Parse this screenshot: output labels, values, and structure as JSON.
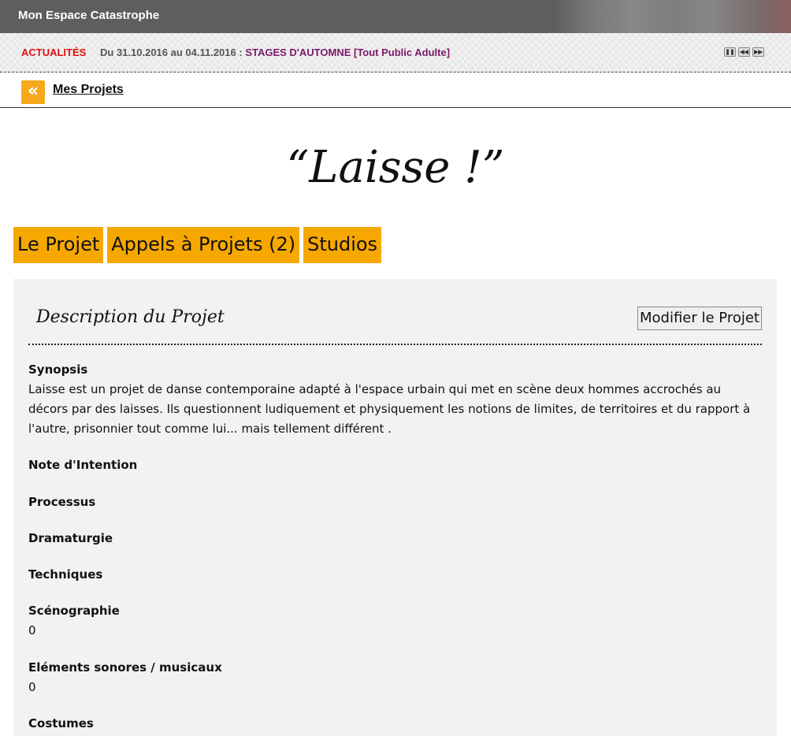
{
  "header": {
    "title": "Mon Espace Catastrophe"
  },
  "news": {
    "label": "ACTUALITÉS",
    "date": "Du 31.10.2016 au 04.11.2016 : ",
    "text": "STAGES D'AUTOMNE [Tout Public Adulte]",
    "controls": [
      "pause-icon",
      "previous-icon",
      "next-icon"
    ]
  },
  "breadcrumb": {
    "back_glyph": "«",
    "link": "Mes Projets"
  },
  "project": {
    "title": "“Laisse !”"
  },
  "tabs": [
    {
      "label": "Le Projet"
    },
    {
      "label": "Appels à Projets (2)"
    },
    {
      "label": "Studios"
    }
  ],
  "panel": {
    "heading": "Description du Projet",
    "edit_button": "Modifier le Projet",
    "sections": [
      {
        "label": "Synopsis",
        "value": "Laisse est un projet de danse contemporaine adapté à l'espace urbain qui met en scène deux hommes accrochés au décors par des laisses. Ils questionnent ludiquement et physiquement les notions de limites, de territoires et du rapport à l'autre, prisonnier tout comme lui... mais tellement différent ."
      },
      {
        "label": "Note d'Intention",
        "value": ""
      },
      {
        "label": "Processus",
        "value": ""
      },
      {
        "label": "Dramaturgie",
        "value": ""
      },
      {
        "label": "Techniques",
        "value": ""
      },
      {
        "label": "Scénographie",
        "value": "0"
      },
      {
        "label": "Eléments sonores / musicaux",
        "value": "0"
      },
      {
        "label": "Costumes",
        "value": ""
      }
    ]
  },
  "colors": {
    "accent": "#f7a800",
    "news_label": "#e01010",
    "news_text": "#7a1a6a"
  }
}
